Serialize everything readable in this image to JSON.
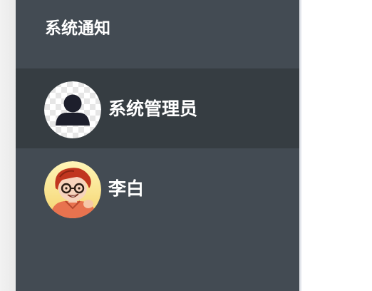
{
  "sidebar": {
    "title": "系统通知",
    "contacts": [
      {
        "name": "系统管理员",
        "avatar": "default-user-silhouette-icon",
        "active": true
      },
      {
        "name": "李白",
        "avatar": "cartoon-boy-glasses-avatar",
        "active": false
      }
    ]
  },
  "colors": {
    "panel_bg": "#434b53",
    "active_row_bg": "#363d42",
    "text": "#ffffff"
  }
}
